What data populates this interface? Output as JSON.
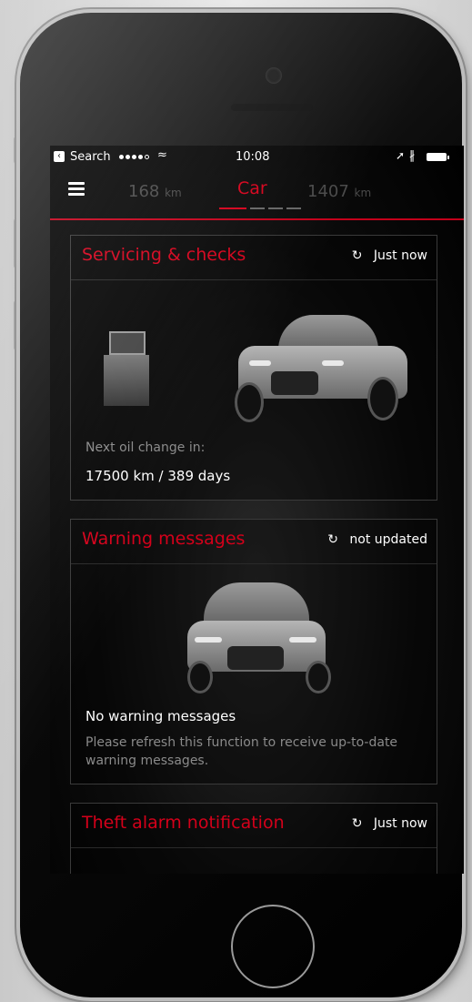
{
  "status_bar": {
    "back_label": "Search",
    "time": "10:08",
    "location_glyph": "➚",
    "bluetooth_glyph": "∦",
    "wifi_glyph": "≈"
  },
  "nav": {
    "tabs": [
      {
        "value": "168",
        "unit": "km"
      },
      {
        "label": "Car"
      },
      {
        "value": "1407",
        "unit": "km"
      }
    ]
  },
  "cards": [
    {
      "title": "Servicing & checks",
      "refresh": "Just now",
      "caption": "Next oil change in:",
      "value": "17500 km / 389 days"
    },
    {
      "title": "Warning messages",
      "refresh": "not updated",
      "headline": "No warning messages",
      "description": "Please refresh this function to receive up-to-date warning messages."
    },
    {
      "title": "Theft alarm notification",
      "refresh": "Just now"
    }
  ],
  "icons": {
    "refresh": "↻",
    "back_chevron": "‹"
  },
  "colors": {
    "accent": "#d4001a",
    "muted_text": "#8a8a8a"
  }
}
